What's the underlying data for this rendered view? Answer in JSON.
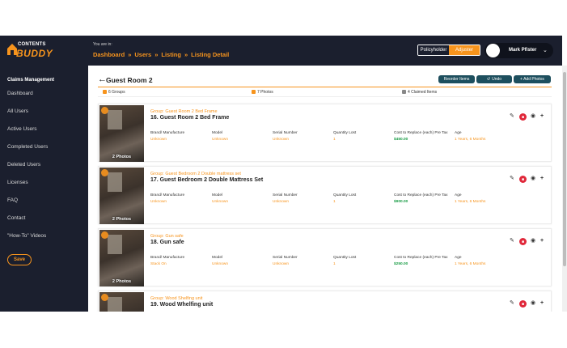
{
  "logo": {
    "top": "CONTENTS",
    "bottom": "BUDDY"
  },
  "header": {
    "you_are_in": "You are in:",
    "breadcrumbs": [
      "Dashboard",
      "Users",
      "Listing",
      "Listing Detail"
    ],
    "separator": "»",
    "roles": [
      "Policyholder",
      "Adjuster"
    ],
    "active_role": "Adjuster",
    "user_name": "Mark Pfister",
    "chevron": "⌄"
  },
  "sidebar": {
    "section": "Claims Management",
    "items": [
      "Dashboard",
      "All Users",
      "Active Users",
      "Completed Users",
      "Deleted Users",
      "Licenses",
      "FAQ",
      "Contact",
      "\"How-To\" Videos"
    ],
    "save_label": "Save"
  },
  "page": {
    "back_arrow": "←",
    "title": "Guest Room 2",
    "buttons": {
      "reorder": "Reorder Items",
      "undo": "Undo",
      "add_photos": "+ Add Photos"
    },
    "summary": {
      "groups": "6 Groups",
      "photos": "7 Photos",
      "claimed": "4 Claimed Items"
    }
  },
  "columns": {
    "brand": "Brand/ Manufacture",
    "model": "Model",
    "serial": "Serial Number",
    "qty": "Quantity Lost",
    "cost": "Cost to Replace (each) Pre Tax",
    "age": "Age"
  },
  "items": [
    {
      "group": "Group: Guest Room 2 Bed Frame",
      "name": "16. Guest Room 2 Bed Frame",
      "photos": "2 Photos",
      "brand": "Unknown",
      "model": "Unknown",
      "serial": "Unknown",
      "qty": "1",
      "cost": "$450.00",
      "age": "1 Years, 6 Months"
    },
    {
      "group": "Group: Guest Bedroom 2 Double mattress set",
      "name": "17. Guest Bedroom 2 Double Mattress Set",
      "photos": "2 Photos",
      "brand": "Unknown",
      "model": "Unknown",
      "serial": "Unknown",
      "qty": "1",
      "cost": "$900.00",
      "age": "1 Years, 6 Months"
    },
    {
      "group": "Group: Gun safe",
      "name": "18. Gun safe",
      "photos": "2 Photos",
      "brand": "Stack On",
      "model": "Unknown",
      "serial": "Unknown",
      "qty": "1",
      "cost": "$250.00",
      "age": "1 Years, 6 Months"
    },
    {
      "group": "Group: Wood Shelfing unit",
      "name": "19. Wood Whelfing unit",
      "photos": "",
      "brand": "",
      "model": "",
      "serial": "",
      "qty": "",
      "cost": "",
      "age": ""
    }
  ],
  "colors": {
    "accent": "#f7941d",
    "nav_bg": "#1b1f2e",
    "button_bg": "#1e4f5e",
    "price": "#1a9c46",
    "delete": "#e0283a"
  },
  "icons": {
    "edit": "pencil-icon",
    "delete": "trash-icon",
    "view": "eye-icon",
    "add": "plus-icon"
  }
}
